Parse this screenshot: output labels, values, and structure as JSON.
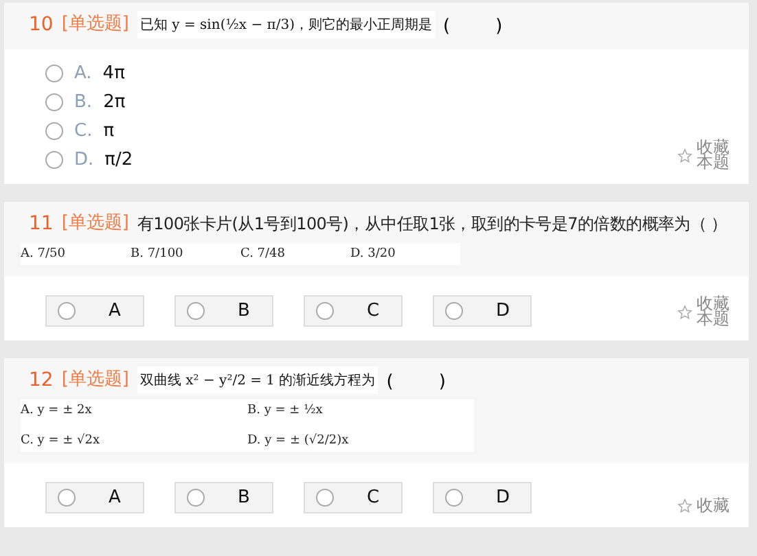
{
  "questions": [
    {
      "number": "10",
      "type": "[单选题]",
      "stem": {
        "kind": "formula",
        "text": "已知 y = sin(½x − π/3)，则它的最小正周期是"
      },
      "blank": "(        )",
      "kind": "list",
      "options": [
        {
          "letter": "A.",
          "text": "4π",
          "selected": false
        },
        {
          "letter": "B.",
          "text": "2π",
          "selected": false
        },
        {
          "letter": "C.",
          "text": "π",
          "selected": false
        },
        {
          "letter": "D.",
          "text": "π/2",
          "selected": false
        }
      ],
      "favorite": {
        "label": "收藏本题",
        "starred": false
      }
    },
    {
      "number": "11",
      "type": "[单选题]",
      "stem": {
        "kind": "text",
        "text": "有100张卡片(从1号到100号)，从中任取1张，取到的卡号是7的倍数的概率为（  ）"
      },
      "kind": "buttons",
      "formula_options": {
        "kind": "row",
        "items": [
          "A. 7/50",
          "B. 7/100",
          "C. 7/48",
          "D. 3/20"
        ]
      },
      "options": [
        {
          "letter": "A",
          "selected": false
        },
        {
          "letter": "B",
          "selected": false
        },
        {
          "letter": "C",
          "selected": false
        },
        {
          "letter": "D",
          "selected": false
        }
      ],
      "favorite": {
        "label": "收藏本题",
        "starred": false
      }
    },
    {
      "number": "12",
      "type": "[单选题]",
      "stem": {
        "kind": "formula",
        "text": "双曲线 x² − y²/2 = 1 的渐近线方程为"
      },
      "blank": "(        )",
      "kind": "buttons",
      "formula_options": {
        "kind": "grid",
        "items": [
          "A. y = ± 2x",
          "B. y = ± ½x",
          "C. y = ± √2x",
          "D. y = ± (√2/2)x"
        ]
      },
      "options": [
        {
          "letter": "A",
          "selected": false
        },
        {
          "letter": "B",
          "selected": false
        },
        {
          "letter": "C",
          "selected": false
        },
        {
          "letter": "D",
          "selected": false
        }
      ],
      "favorite": {
        "label": "收藏",
        "starred": false
      }
    }
  ]
}
